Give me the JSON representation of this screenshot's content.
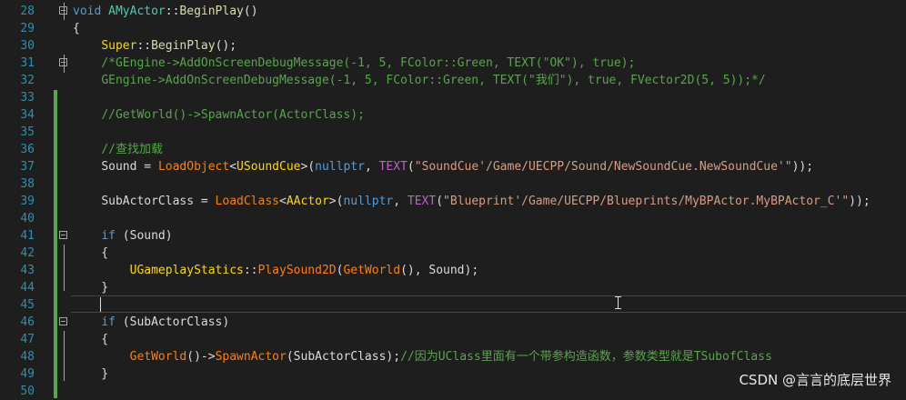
{
  "editor": {
    "lines": [
      {
        "num": "28",
        "fold": true,
        "segments": [
          {
            "cls": "kw",
            "text": "void "
          },
          {
            "cls": "cls",
            "text": "AMyActor"
          },
          {
            "cls": "wht",
            "text": "::"
          },
          {
            "cls": "fn",
            "text": "BeginPlay"
          },
          {
            "cls": "wht",
            "text": "()"
          }
        ]
      },
      {
        "num": "29",
        "fold": false,
        "segments": [
          {
            "cls": "wht",
            "text": "{"
          }
        ]
      },
      {
        "num": "30",
        "fold": false,
        "segments": [
          {
            "cls": "wht",
            "text": "    "
          },
          {
            "cls": "yel",
            "text": "Super"
          },
          {
            "cls": "wht",
            "text": "::"
          },
          {
            "cls": "fn",
            "text": "BeginPlay"
          },
          {
            "cls": "wht",
            "text": "();"
          }
        ]
      },
      {
        "num": "31",
        "fold": true,
        "segments": [
          {
            "cls": "wht",
            "text": "    "
          },
          {
            "cls": "cmt",
            "text": "/*GEngine->AddOnScreenDebugMessage(-1, 5, FColor::Green, TEXT(\"OK\"), true);"
          }
        ]
      },
      {
        "num": "32",
        "fold": false,
        "segments": [
          {
            "cls": "wht",
            "text": "    "
          },
          {
            "cls": "cmt",
            "text": "GEngine->AddOnScreenDebugMessage(-1, 5, FColor::Green, TEXT(\"我们\"), true, FVector2D(5, 5));*/"
          }
        ]
      },
      {
        "num": "33",
        "fold": false,
        "segments": []
      },
      {
        "num": "34",
        "fold": false,
        "segments": [
          {
            "cls": "wht",
            "text": "    "
          },
          {
            "cls": "cmt",
            "text": "//GetWorld()->SpawnActor(ActorClass);"
          }
        ]
      },
      {
        "num": "35",
        "fold": false,
        "segments": []
      },
      {
        "num": "36",
        "fold": false,
        "segments": [
          {
            "cls": "wht",
            "text": "    "
          },
          {
            "cls": "cmt",
            "text": "//查找加载"
          }
        ]
      },
      {
        "num": "37",
        "fold": false,
        "segments": [
          {
            "cls": "wht",
            "text": "    "
          },
          {
            "cls": "var",
            "text": "Sound = "
          },
          {
            "cls": "org",
            "text": "LoadObject"
          },
          {
            "cls": "wht",
            "text": "<"
          },
          {
            "cls": "yel",
            "text": "USoundCue"
          },
          {
            "cls": "wht",
            "text": ">("
          },
          {
            "cls": "kw",
            "text": "nullptr"
          },
          {
            "cls": "wht",
            "text": ", "
          },
          {
            "cls": "mac",
            "text": "TEXT"
          },
          {
            "cls": "wht",
            "text": "("
          },
          {
            "cls": "str",
            "text": "\"SoundCue'/Game/UECPP/Sound/NewSoundCue.NewSoundCue'\""
          },
          {
            "cls": "wht",
            "text": "));"
          }
        ]
      },
      {
        "num": "38",
        "fold": false,
        "segments": []
      },
      {
        "num": "39",
        "fold": false,
        "segments": [
          {
            "cls": "wht",
            "text": "    "
          },
          {
            "cls": "var",
            "text": "SubActorClass = "
          },
          {
            "cls": "org",
            "text": "LoadClass"
          },
          {
            "cls": "wht",
            "text": "<"
          },
          {
            "cls": "yel",
            "text": "AActor"
          },
          {
            "cls": "wht",
            "text": ">("
          },
          {
            "cls": "kw",
            "text": "nullptr"
          },
          {
            "cls": "wht",
            "text": ", "
          },
          {
            "cls": "mac",
            "text": "TEXT"
          },
          {
            "cls": "wht",
            "text": "("
          },
          {
            "cls": "str",
            "text": "\"Blueprint'/Game/UECPP/Blueprints/MyBPActor.MyBPActor_C'\""
          },
          {
            "cls": "wht",
            "text": "));"
          }
        ]
      },
      {
        "num": "40",
        "fold": false,
        "segments": []
      },
      {
        "num": "41",
        "fold": true,
        "segments": [
          {
            "cls": "wht",
            "text": "    "
          },
          {
            "cls": "kw",
            "text": "if"
          },
          {
            "cls": "wht",
            "text": " (Sound)"
          }
        ]
      },
      {
        "num": "42",
        "fold": false,
        "segments": [
          {
            "cls": "wht",
            "text": "    {"
          }
        ]
      },
      {
        "num": "43",
        "fold": false,
        "segments": [
          {
            "cls": "wht",
            "text": "        "
          },
          {
            "cls": "yel",
            "text": "UGameplayStatics"
          },
          {
            "cls": "wht",
            "text": "::"
          },
          {
            "cls": "org",
            "text": "PlaySound2D"
          },
          {
            "cls": "wht",
            "text": "("
          },
          {
            "cls": "org",
            "text": "GetWorld"
          },
          {
            "cls": "wht",
            "text": "(), Sound);"
          }
        ]
      },
      {
        "num": "44",
        "fold": false,
        "segments": [
          {
            "cls": "wht",
            "text": "    }"
          }
        ]
      },
      {
        "num": "45",
        "fold": false,
        "segments": []
      },
      {
        "num": "46",
        "fold": true,
        "segments": [
          {
            "cls": "wht",
            "text": "    "
          },
          {
            "cls": "kw",
            "text": "if"
          },
          {
            "cls": "wht",
            "text": " (SubActorClass)"
          }
        ]
      },
      {
        "num": "47",
        "fold": false,
        "segments": [
          {
            "cls": "wht",
            "text": "    {"
          }
        ]
      },
      {
        "num": "48",
        "fold": false,
        "segments": [
          {
            "cls": "wht",
            "text": "        "
          },
          {
            "cls": "org",
            "text": "GetWorld"
          },
          {
            "cls": "wht",
            "text": "()->"
          },
          {
            "cls": "org",
            "text": "SpawnActor"
          },
          {
            "cls": "wht",
            "text": "(SubActorClass);"
          },
          {
            "cls": "cmt",
            "text": "//因为UClass里面有一个带参构造函数，参数类型就是TSubofClass"
          }
        ]
      },
      {
        "num": "49",
        "fold": false,
        "segments": [
          {
            "cls": "wht",
            "text": "    }"
          }
        ]
      },
      {
        "num": "50",
        "fold": false,
        "segments": []
      }
    ]
  },
  "watermark": "CSDN @言言的底层世界",
  "colors": {
    "background": "#1e1e1e",
    "line_number": "#2b91af",
    "keyword": "#569cd6",
    "comment": "#57a64a",
    "string": "#d69d85"
  }
}
